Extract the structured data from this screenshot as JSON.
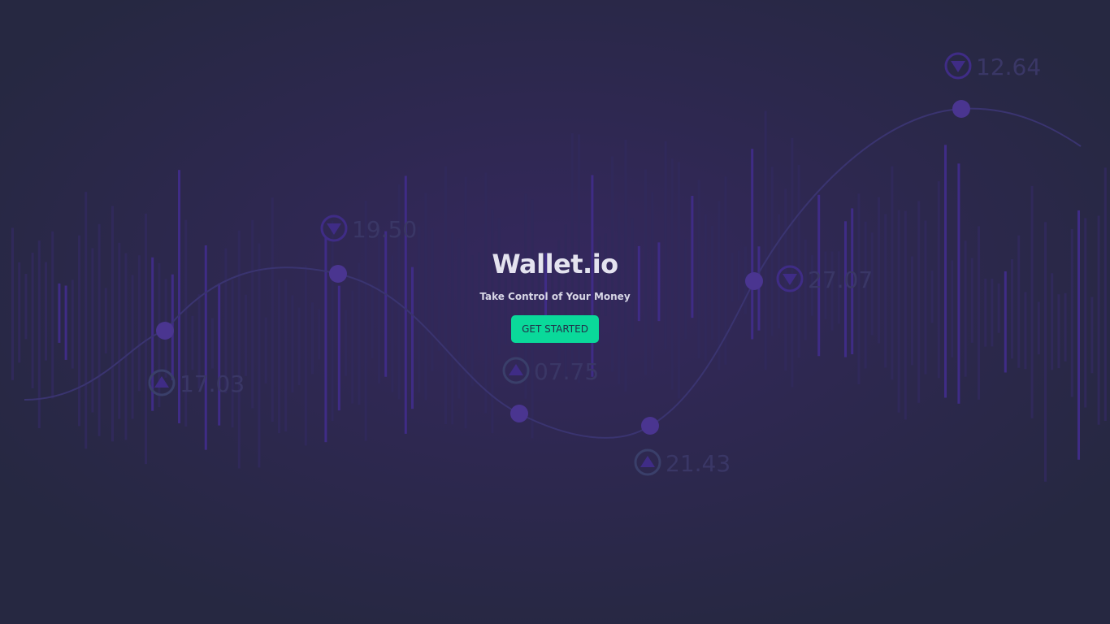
{
  "hero": {
    "title": "Wallet.io",
    "tagline": "Take Control of Your Money",
    "cta_label": "GET STARTED"
  },
  "markers": [
    {
      "value": "17.03",
      "direction": "up",
      "icon": "up-arrow-circle-icon"
    },
    {
      "value": "19.50",
      "direction": "down",
      "icon": "down-arrow-circle-icon"
    },
    {
      "value": "07.75",
      "direction": "up",
      "icon": "up-arrow-circle-icon"
    },
    {
      "value": "21.43",
      "direction": "up",
      "icon": "up-arrow-circle-icon"
    },
    {
      "value": "27.07",
      "direction": "down",
      "icon": "down-arrow-circle-icon"
    },
    {
      "value": "12.64",
      "direction": "down",
      "icon": "down-arrow-circle-icon"
    }
  ],
  "colors": {
    "accent": "#0ad99a",
    "background": "#262841",
    "purple": "#4b2fa0"
  }
}
